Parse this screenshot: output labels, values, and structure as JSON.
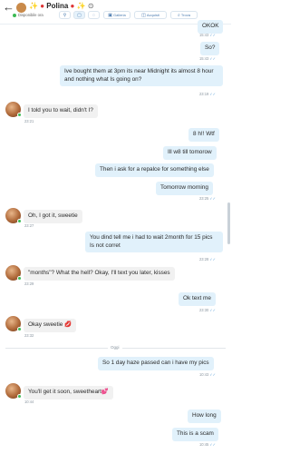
{
  "header": {
    "back_icon": "←",
    "title_prefix": "✨",
    "title_name": "Polina",
    "title_suffix": "✨",
    "status": "Disponibile ora",
    "nav": [
      {
        "icon": "profile",
        "label": ""
      },
      {
        "icon": "message",
        "label": ""
      },
      {
        "icon": "image",
        "label": "Galleria"
      },
      {
        "icon": "bag",
        "label": "Acquisti"
      },
      {
        "icon": "search",
        "label": "Trova"
      }
    ],
    "accent_color": "#4a7bb0",
    "online_color": "#3cba54"
  },
  "messages": [
    {
      "dir": "out",
      "text": "OKOK",
      "time": "15:43",
      "read": true
    },
    {
      "dir": "out",
      "text": "So?",
      "time": "15:43",
      "read": true
    },
    {
      "dir": "out",
      "text": "Ive bought them at 3pm its near Midnight its almost 8 hour and nothing what Is going on?",
      "time": "23:19",
      "read": true
    },
    {
      "dir": "in",
      "text": "I told you to wait, didn't I?",
      "time": "23:21"
    },
    {
      "dir": "out",
      "text": "8 h!! Wtf",
      "time": "",
      "read": false
    },
    {
      "dir": "out",
      "text": "Ill w8 till tomorow",
      "time": "",
      "read": false
    },
    {
      "dir": "out",
      "text": "Then i ask for a repalce for something else",
      "time": "",
      "read": false
    },
    {
      "dir": "out",
      "text": "Tomorrow morning",
      "time": "23:25",
      "read": true
    },
    {
      "dir": "in",
      "text": "Oh, I got it, sweetie",
      "time": "23:27"
    },
    {
      "dir": "out",
      "text": "You dind tell me i had to wait 2month for 15 pics Is not corret",
      "time": "23:28",
      "read": true
    },
    {
      "dir": "in",
      "text": "\"months\"? What the hell? Okay, I'll text you later, kisses",
      "time": "23:29"
    },
    {
      "dir": "out",
      "text": "Ok text me",
      "time": "23:30",
      "read": true
    },
    {
      "dir": "in",
      "text": "Okay sweetie",
      "emoji": "💋",
      "time": "23:32"
    },
    {
      "dir": "out",
      "text": "So 1 day haze passed can i have my pics",
      "time": "10:43",
      "read": true
    },
    {
      "dir": "in",
      "text": "You'll get it soon, sweetheart",
      "emoji": "💕",
      "time": "10:44"
    },
    {
      "dir": "out",
      "text": "How long",
      "time": "",
      "read": false
    },
    {
      "dir": "out",
      "text": "This is a scam",
      "time": "10:45",
      "read": true
    }
  ],
  "day_separator": "Oggi",
  "tick_icon": "✓✓"
}
